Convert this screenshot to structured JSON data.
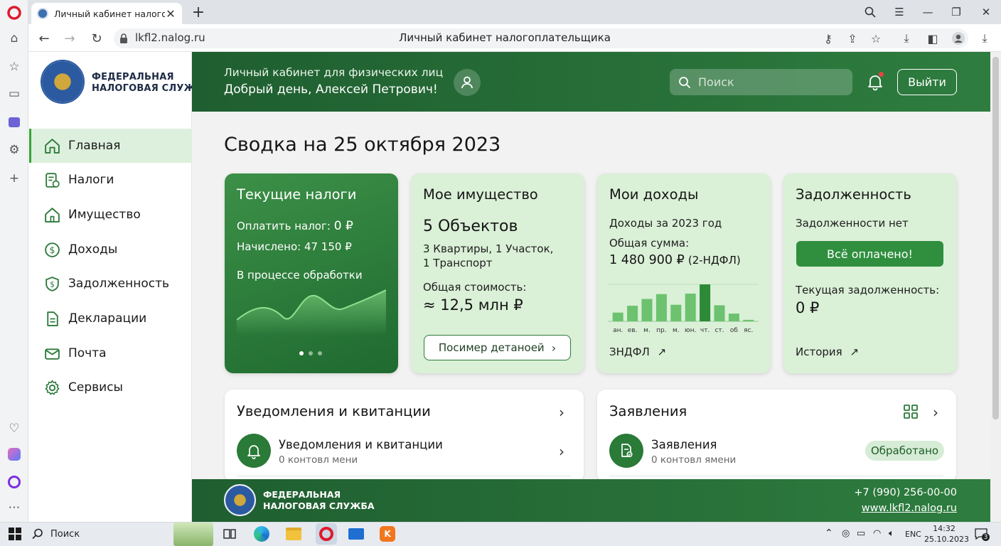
{
  "browser": {
    "tab_title": "Личный кабинет налогоплательщика",
    "url": "lkfl2.nalog.ru",
    "page_title": "Личный кабинет налогоплательщика"
  },
  "site": {
    "logo_text_line1": "ФЕДЕРАЛЬНАЯ",
    "logo_text_line2": "НАЛОГОВАЯ СЛУЖБА",
    "nav": [
      {
        "label": "Главная",
        "icon": "home-icon"
      },
      {
        "label": "Налоги",
        "icon": "document-icon"
      },
      {
        "label": "Имущество",
        "icon": "house-icon"
      },
      {
        "label": "Доходы",
        "icon": "dollar-icon"
      },
      {
        "label": "Задолженность",
        "icon": "shield-dollar-icon"
      },
      {
        "label": "Декларации",
        "icon": "file-icon"
      },
      {
        "label": "Почта",
        "icon": "mail-icon"
      },
      {
        "label": "Сервисы",
        "icon": "gear-icon"
      }
    ]
  },
  "header": {
    "subtitle": "Личный кабинет для физических лиц",
    "greeting": "Добрый день, Алексей Петрович!",
    "search_placeholder": "Поиск",
    "logout_label": "Выйти"
  },
  "summary": {
    "title": "Сводка на 25 октября 2023"
  },
  "cards": {
    "taxes": {
      "title": "Текущие налоги",
      "pay_label": "Оплатить налог:",
      "pay_value": "0 ₽",
      "charged": "Начислено: 47 150 ₽",
      "status": "В процессе обработки"
    },
    "property": {
      "title": "Мое имущество",
      "count": "5 Объектов",
      "detail_line1": "3 Квартиры, 1 Участок,",
      "detail_line2": "1 Транспорт",
      "total_label": "Общая стоимость:",
      "total_value": "≈ 12,5 млн ₽",
      "button": "Посимер детаноей"
    },
    "income": {
      "title": "Мои доходы",
      "period": "Доходы за 2023 год",
      "total_label": "Общая сумма:",
      "total_value": "1 480 900 ₽",
      "total_note": "(2-НДФЛ)",
      "link": "ЗНДФЛ"
    },
    "debt": {
      "title": "Задолженность",
      "status": "Задолженности нет",
      "button": "Всё оплачено!",
      "current_label": "Текущая задолженность:",
      "current_value": "0 ₽",
      "link": "История"
    }
  },
  "chart_data": {
    "type": "bar",
    "categories": [
      "ан.",
      "ев.",
      "м.",
      "пр.",
      "м.",
      "юн.",
      "чт.",
      "ст.",
      "об",
      "яс."
    ],
    "values": [
      1.8,
      3.2,
      4.6,
      5.6,
      3.4,
      5.7,
      7.6,
      3.3,
      1.6,
      0.3
    ],
    "highlight_index": 6,
    "colors": {
      "bar": "#6cc26f",
      "highlight": "#2c8a38"
    }
  },
  "panels": {
    "notifications": {
      "title": "Уведомления и квитанции",
      "item_title": "Уведомления и квитанции",
      "item_sub": "0 контовл мени"
    },
    "applications": {
      "title": "Заявления",
      "item_title": "Заявления",
      "item_sub": "0 контовл ямени",
      "badge": "Обработано"
    }
  },
  "footer": {
    "logo_line1": "ФЕДЕРАЛЬНАЯ",
    "logo_line2": "НАЛОГОВАЯ СЛУЖБА",
    "phone": "+7 (990) 256-00-00",
    "site": "www.lkfl2.nalog.ru"
  },
  "taskbar": {
    "search_label": "Поиск",
    "lang": "ENC",
    "time": "14:32",
    "date": "25.10.2023",
    "notif_count": "3"
  }
}
